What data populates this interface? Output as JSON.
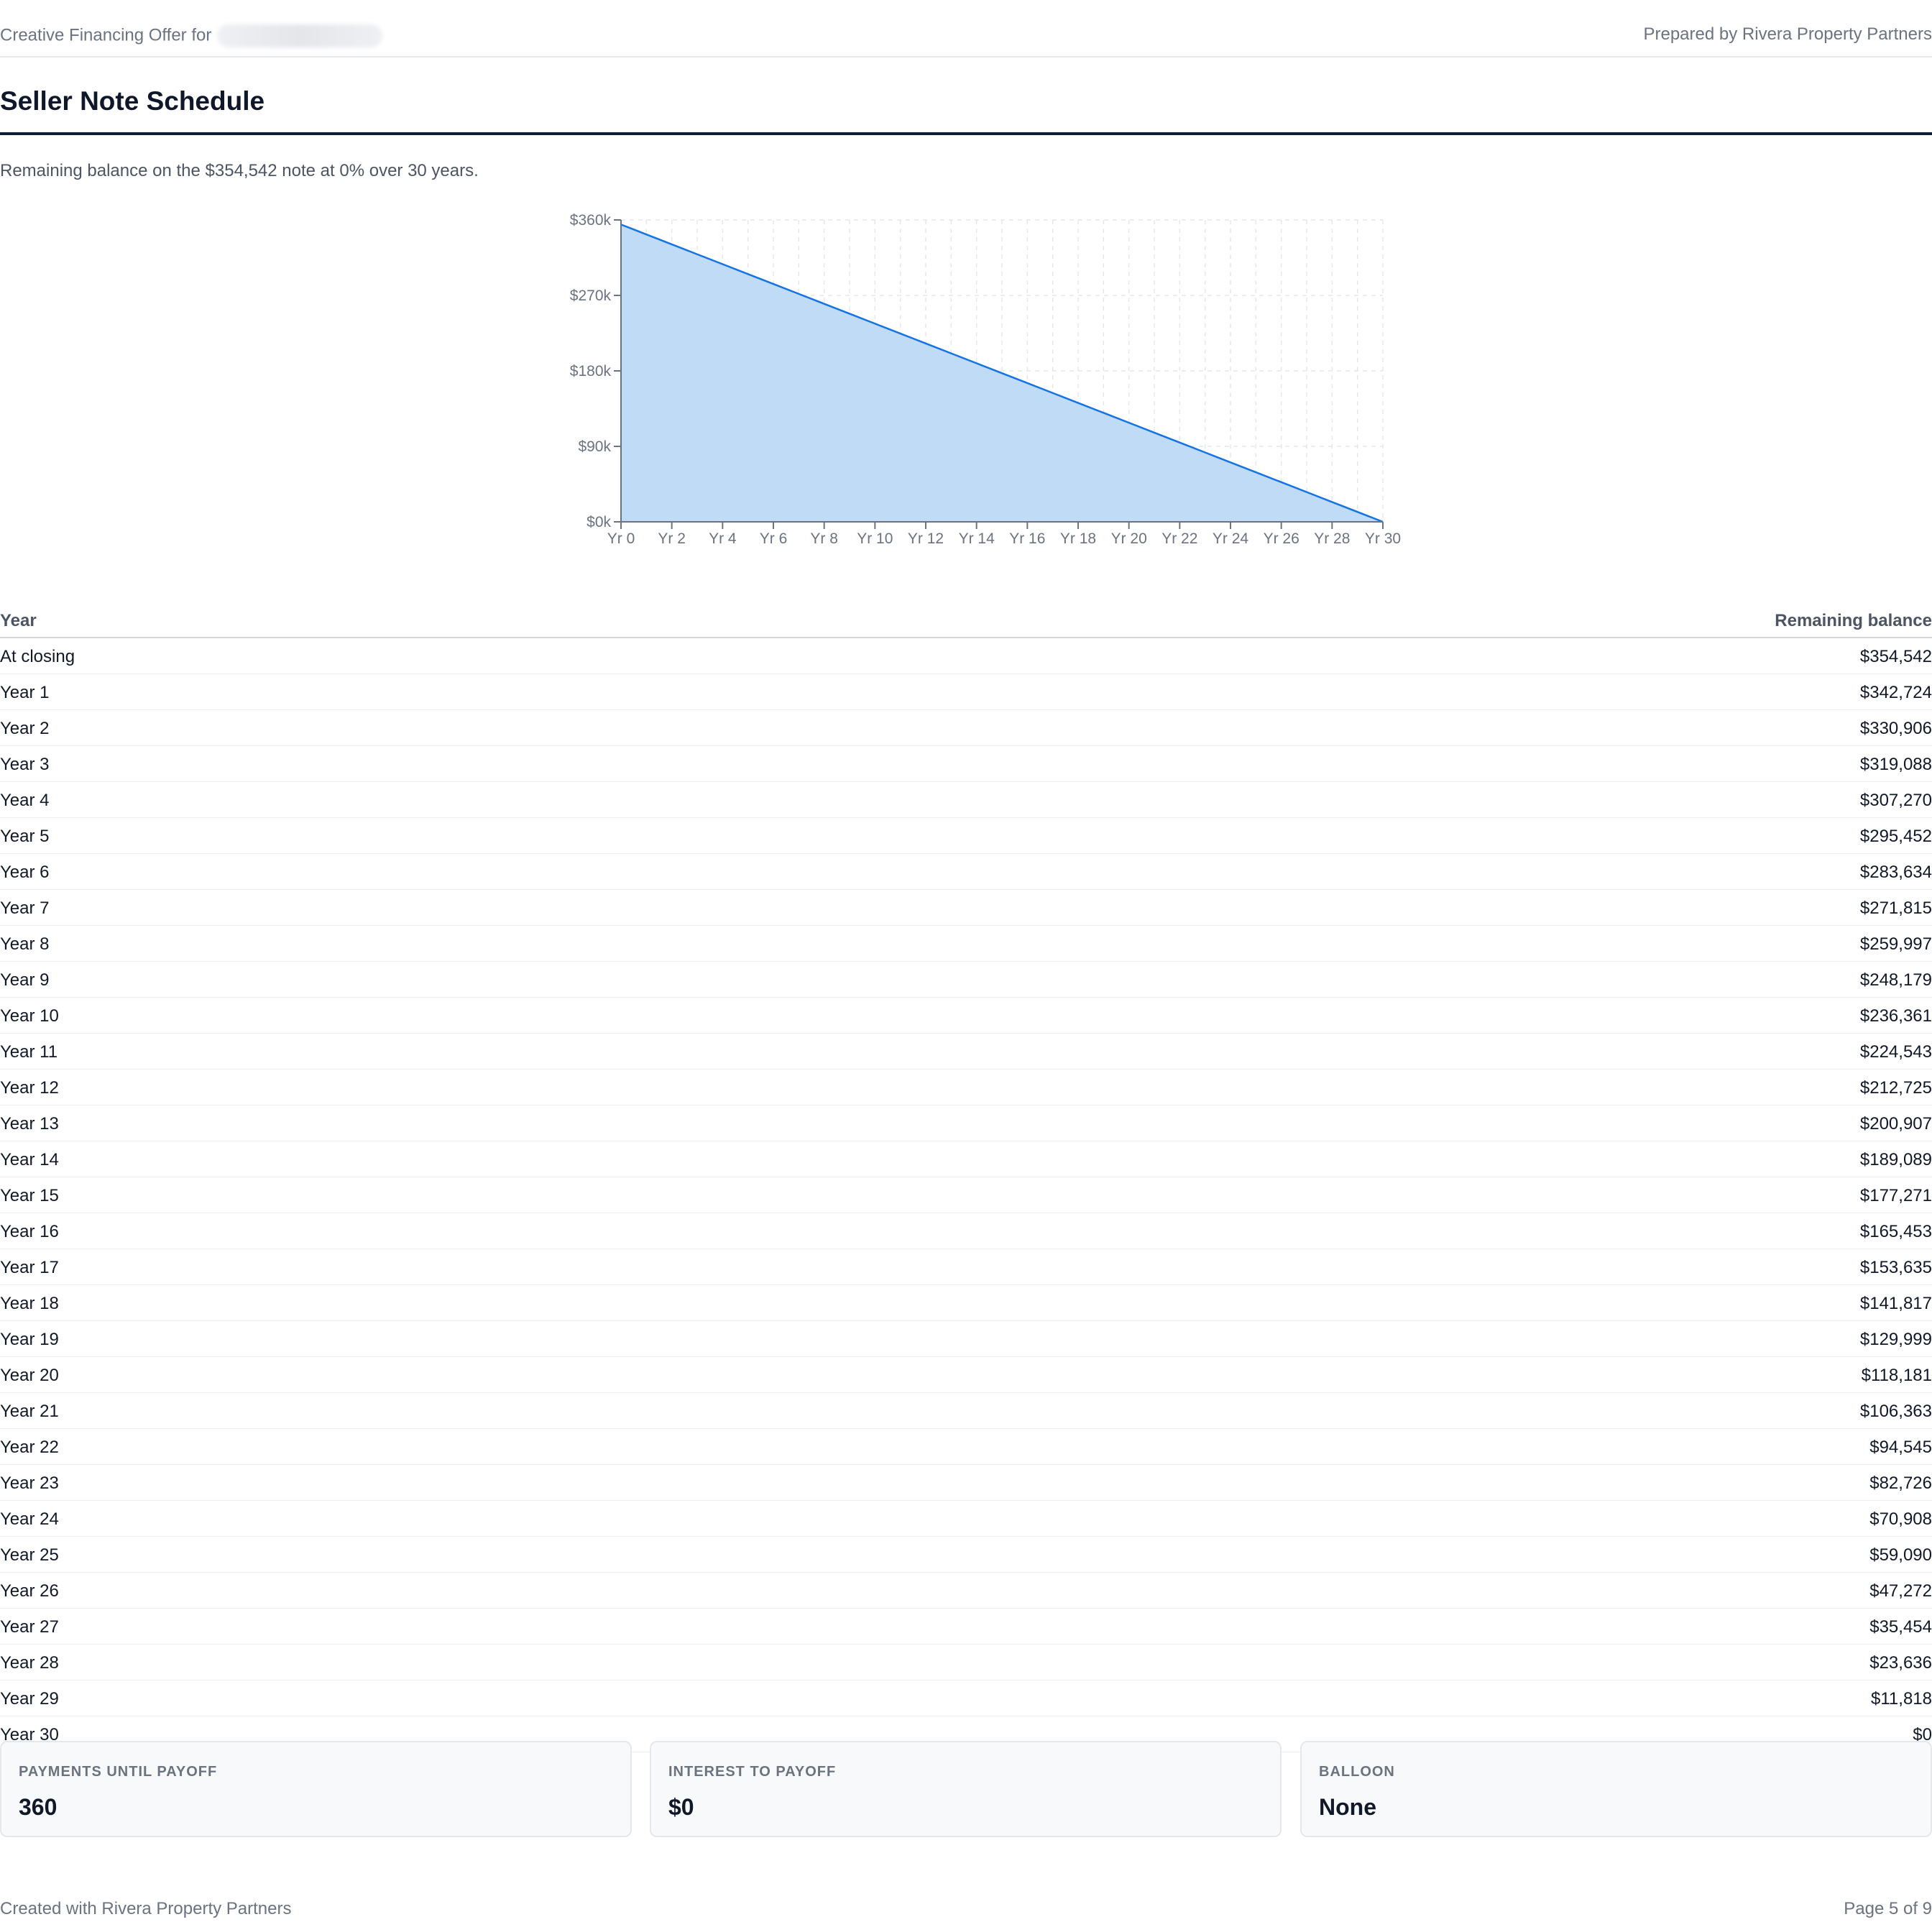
{
  "header": {
    "offer_prefix": "Creative Financing Offer for",
    "prepared_by": "Prepared by Rivera Property Partners"
  },
  "page_title": "Seller Note Schedule",
  "subtitle": "Remaining balance on the $354,542 note at 0% over 30 years.",
  "chart_data": {
    "type": "area",
    "title": "",
    "xlabel": "",
    "ylabel": "",
    "x": [
      0,
      1,
      2,
      3,
      4,
      5,
      6,
      7,
      8,
      9,
      10,
      11,
      12,
      13,
      14,
      15,
      16,
      17,
      18,
      19,
      20,
      21,
      22,
      23,
      24,
      25,
      26,
      27,
      28,
      29,
      30
    ],
    "values": [
      354542,
      342724,
      330906,
      319088,
      307270,
      295452,
      283634,
      271815,
      259997,
      248179,
      236361,
      224543,
      212725,
      200907,
      189089,
      177271,
      165453,
      153635,
      141817,
      129999,
      118181,
      106363,
      94545,
      82726,
      70908,
      59090,
      47272,
      35454,
      23636,
      11818,
      0
    ],
    "xlim": [
      0,
      30
    ],
    "ylim": [
      0,
      360000
    ],
    "x_ticks": [
      "Yr 0",
      "Yr 2",
      "Yr 4",
      "Yr 6",
      "Yr 8",
      "Yr 10",
      "Yr 12",
      "Yr 14",
      "Yr 16",
      "Yr 18",
      "Yr 20",
      "Yr 22",
      "Yr 24",
      "Yr 26",
      "Yr 28",
      "Yr 30"
    ],
    "y_ticks": [
      "$0k",
      "$90k",
      "$180k",
      "$270k",
      "$360k"
    ],
    "grid": true,
    "colors": {
      "line": "#1473e6",
      "fill": "#bfdbf5",
      "grid": "#e5e7eb",
      "axis": "#6b7280"
    }
  },
  "table": {
    "columns": [
      "Year",
      "Remaining balance"
    ],
    "rows": [
      [
        "At closing",
        "$354,542"
      ],
      [
        "Year 1",
        "$342,724"
      ],
      [
        "Year 2",
        "$330,906"
      ],
      [
        "Year 3",
        "$319,088"
      ],
      [
        "Year 4",
        "$307,270"
      ],
      [
        "Year 5",
        "$295,452"
      ],
      [
        "Year 6",
        "$283,634"
      ],
      [
        "Year 7",
        "$271,815"
      ],
      [
        "Year 8",
        "$259,997"
      ],
      [
        "Year 9",
        "$248,179"
      ],
      [
        "Year 10",
        "$236,361"
      ],
      [
        "Year 11",
        "$224,543"
      ],
      [
        "Year 12",
        "$212,725"
      ],
      [
        "Year 13",
        "$200,907"
      ],
      [
        "Year 14",
        "$189,089"
      ],
      [
        "Year 15",
        "$177,271"
      ],
      [
        "Year 16",
        "$165,453"
      ],
      [
        "Year 17",
        "$153,635"
      ],
      [
        "Year 18",
        "$141,817"
      ],
      [
        "Year 19",
        "$129,999"
      ],
      [
        "Year 20",
        "$118,181"
      ],
      [
        "Year 21",
        "$106,363"
      ],
      [
        "Year 22",
        "$94,545"
      ],
      [
        "Year 23",
        "$82,726"
      ],
      [
        "Year 24",
        "$70,908"
      ],
      [
        "Year 25",
        "$59,090"
      ],
      [
        "Year 26",
        "$47,272"
      ],
      [
        "Year 27",
        "$35,454"
      ],
      [
        "Year 28",
        "$23,636"
      ],
      [
        "Year 29",
        "$11,818"
      ],
      [
        "Year 30",
        "$0"
      ]
    ]
  },
  "summary": {
    "payments": {
      "label": "PAYMENTS UNTIL PAYOFF",
      "value": "360"
    },
    "interest": {
      "label": "INTEREST TO PAYOFF",
      "value": "$0"
    },
    "balloon": {
      "label": "BALLOON",
      "value": "None"
    }
  },
  "footer": {
    "created_with": "Created with Rivera Property Partners",
    "page": "Page 5 of 9"
  }
}
